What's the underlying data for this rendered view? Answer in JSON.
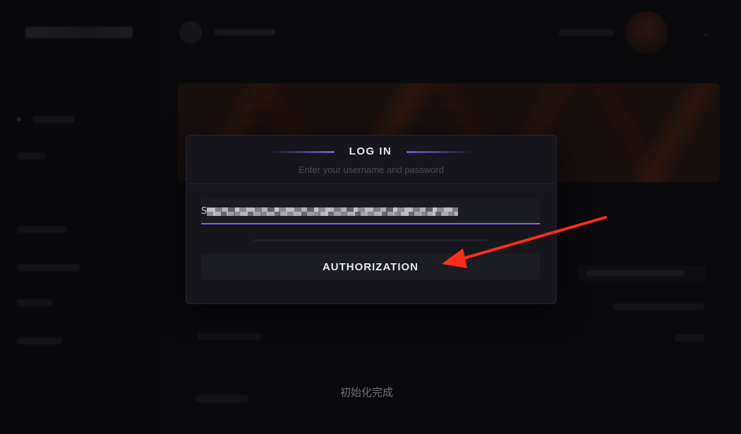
{
  "modal": {
    "title": "LOG IN",
    "subtitle": "Enter your username and password",
    "username_prefix": "S",
    "authorize_label": "AUTHORIZATION"
  },
  "footer": {
    "status_text": "初始化完成"
  },
  "colors": {
    "accent": "#7a64e8",
    "annotation_arrow": "#ff2d1a"
  },
  "icons": {
    "dropdown": "chevron-down-icon"
  }
}
